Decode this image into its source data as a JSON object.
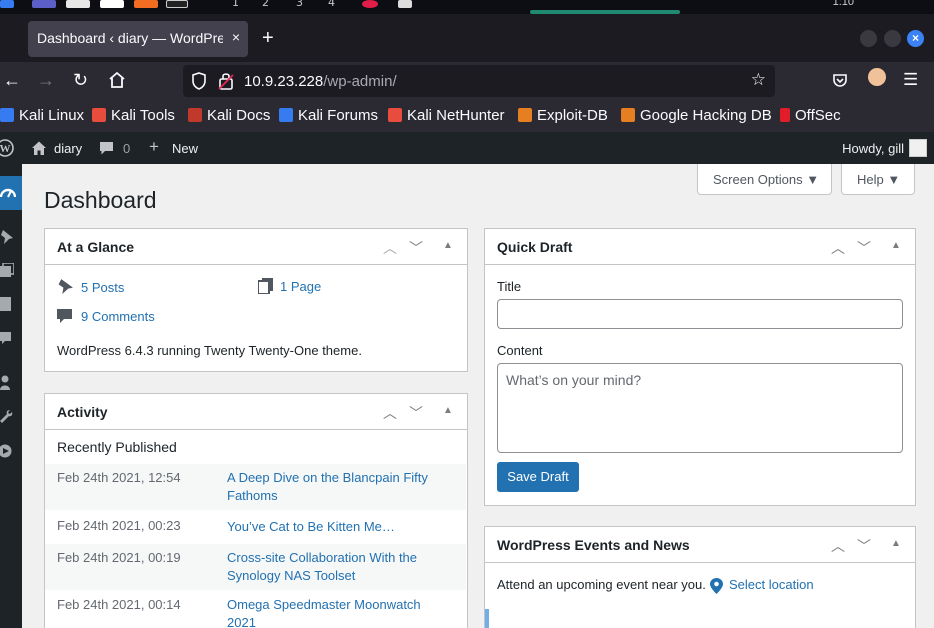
{
  "os_bar": {
    "workspaces": [
      "1",
      "2",
      "3",
      "4"
    ],
    "clock": "1:10"
  },
  "browser": {
    "tab_title": "Dashboard ‹ diary — WordPress",
    "tab_close": "×",
    "new_tab": "+",
    "url_host": "10.9.23.228",
    "url_path": "/wp-admin/",
    "bookmarks": [
      {
        "label": "Kali Linux",
        "color": "#367bf0"
      },
      {
        "label": "Kali Tools",
        "color": "#e74c3c"
      },
      {
        "label": "Kali Docs",
        "color": "#c0392b"
      },
      {
        "label": "Kali Forums",
        "color": "#367bf0"
      },
      {
        "label": "Kali NetHunter",
        "color": "#e74c3c"
      },
      {
        "label": "Exploit-DB",
        "color": "#e67e22"
      },
      {
        "label": "Google Hacking DB",
        "color": "#e67e22"
      },
      {
        "label": "OffSec",
        "color": "#e11d2a"
      }
    ]
  },
  "adminbar": {
    "site_name": "diary",
    "comments_count": "0",
    "new_label": "New",
    "howdy": "Howdy, gill"
  },
  "dashboard": {
    "title": "Dashboard",
    "screen_options": "Screen Options ▼",
    "help": "Help ▼"
  },
  "at_a_glance": {
    "title": "At a Glance",
    "posts": "5 Posts",
    "pages": "1 Page",
    "comments": "9 Comments",
    "version_text": "WordPress 6.4.3 running Twenty Twenty-One theme."
  },
  "activity": {
    "title": "Activity",
    "subtitle": "Recently Published",
    "items": [
      {
        "date": "Feb 24th 2021, 12:54",
        "title": "A Deep Dive on the Blancpain Fifty Fathoms"
      },
      {
        "date": "Feb 24th 2021, 00:23",
        "title": "You’ve Cat to Be Kitten Me…"
      },
      {
        "date": "Feb 24th 2021, 00:19",
        "title": "Cross-site Collaboration With the Synology NAS Toolset"
      },
      {
        "date": "Feb 24th 2021, 00:14",
        "title": "Omega Speedmaster Moonwatch 2021"
      }
    ]
  },
  "quick_draft": {
    "title": "Quick Draft",
    "title_label": "Title",
    "content_label": "Content",
    "content_placeholder": "What’s on your mind?",
    "save_label": "Save Draft"
  },
  "events": {
    "title": "WordPress Events and News",
    "attend_text": "Attend an upcoming event near you.",
    "select_location": "Select location"
  }
}
